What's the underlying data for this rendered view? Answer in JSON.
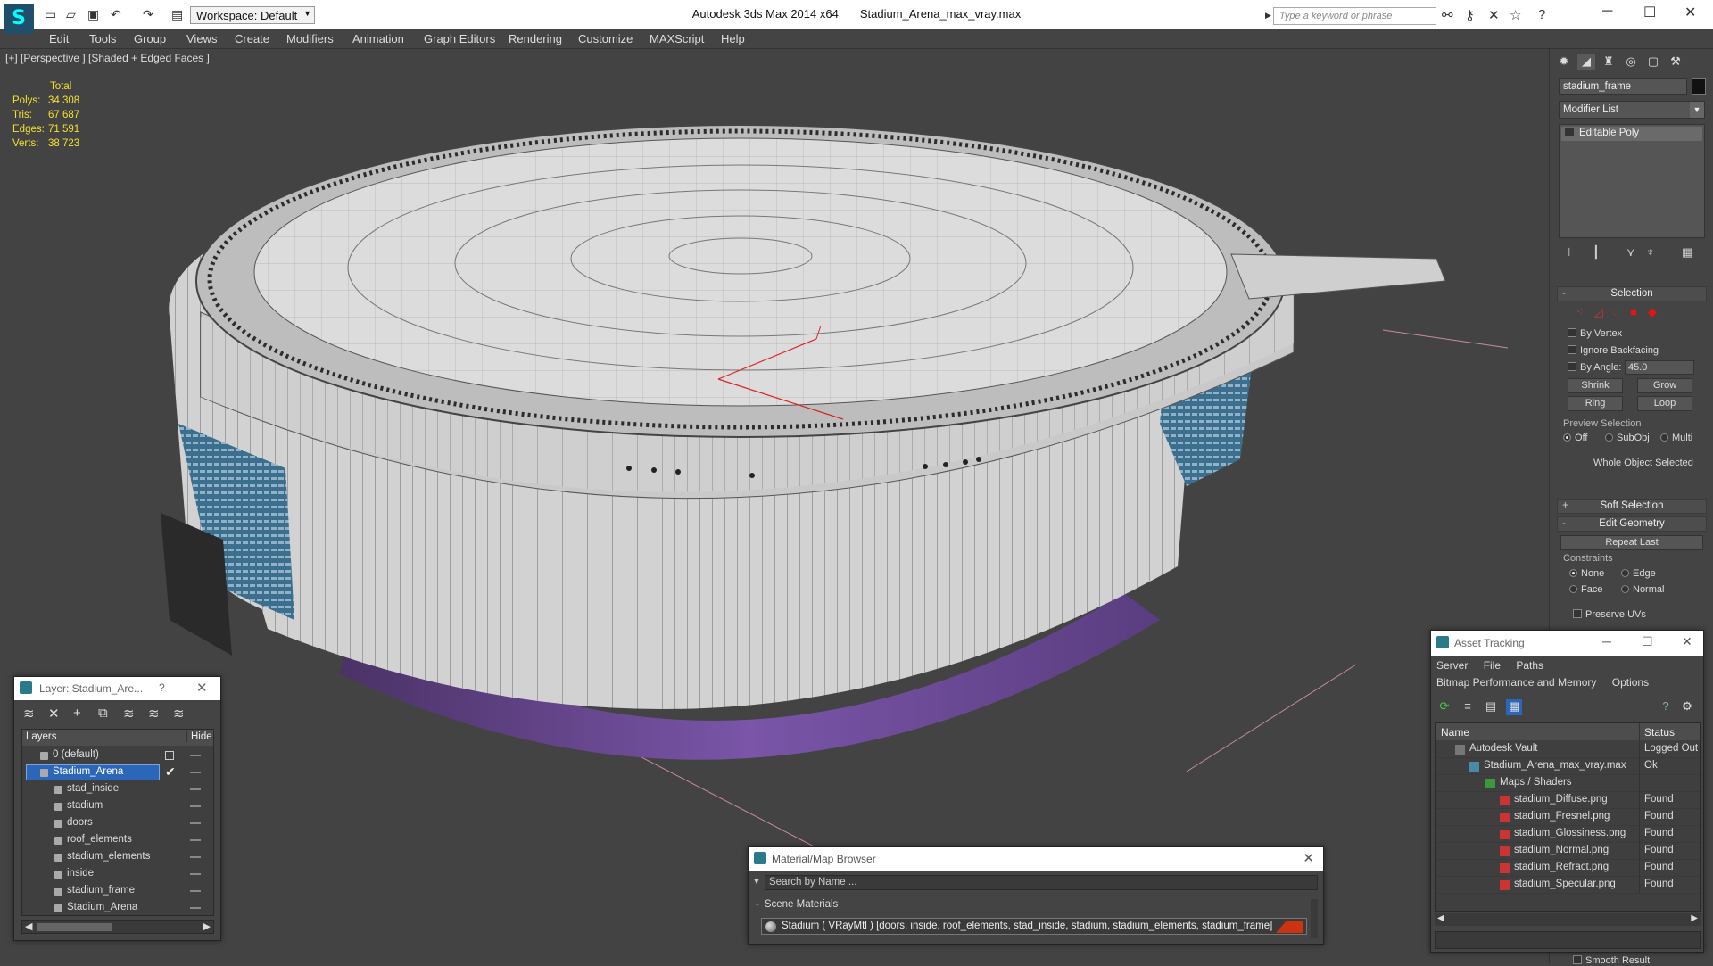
{
  "app": {
    "title": "Autodesk 3ds Max  2014 x64",
    "file": "Stadium_Arena_max_vray.max",
    "workspace": "Workspace: Default",
    "search_placeholder": "Type a keyword or phrase"
  },
  "menu": [
    "Edit",
    "Tools",
    "Group",
    "Views",
    "Create",
    "Modifiers",
    "Animation",
    "Graph Editors",
    "Rendering",
    "Customize",
    "MAXScript",
    "Help"
  ],
  "viewport": {
    "label": "[+] [Perspective ] [Shaded + Edged Faces ]",
    "stats": {
      "header": "Total",
      "rows": [
        {
          "k": "Polys:",
          "v": "34 308"
        },
        {
          "k": "Tris:",
          "v": "67 687"
        },
        {
          "k": "Edges:",
          "v": "71 591"
        },
        {
          "k": "Verts:",
          "v": "38 723"
        }
      ]
    }
  },
  "command_panel": {
    "object_name": "stadium_frame",
    "modifier_list": "Modifier List",
    "stack_item": "Editable Poly",
    "selection": {
      "title": "Selection",
      "by_vertex": "By Vertex",
      "ignore_backfacing": "Ignore Backfacing",
      "by_angle": "By Angle:",
      "angle_value": "45.0",
      "shrink": "Shrink",
      "grow": "Grow",
      "ring": "Ring",
      "loop": "Loop",
      "preview_selection": "Preview Selection",
      "off": "Off",
      "subobj": "SubObj",
      "multi": "Multi",
      "status": "Whole Object Selected"
    },
    "soft_selection": "Soft Selection",
    "edit_geometry": {
      "title": "Edit Geometry",
      "repeat_last": "Repeat Last",
      "constraints": "Constraints",
      "none": "None",
      "edge": "Edge",
      "face": "Face",
      "normal": "Normal",
      "preserve_uvs": "Preserve UVs",
      "smooth_result": "Smooth Result"
    }
  },
  "layer_panel": {
    "title": "Layer: Stadium_Are...",
    "help": "?",
    "col_layers": "Layers",
    "col_hide": "Hide",
    "rows": [
      {
        "name": "0 (default)",
        "level": 0
      },
      {
        "name": "Stadium_Arena",
        "level": 0,
        "selected": true
      },
      {
        "name": "stad_inside",
        "level": 1
      },
      {
        "name": "stadium",
        "level": 1
      },
      {
        "name": "doors",
        "level": 1
      },
      {
        "name": "roof_elements",
        "level": 1
      },
      {
        "name": "stadium_elements",
        "level": 1
      },
      {
        "name": "inside",
        "level": 1
      },
      {
        "name": "stadium_frame",
        "level": 1
      },
      {
        "name": "Stadium_Arena",
        "level": 1
      }
    ]
  },
  "material_browser": {
    "title": "Material/Map Browser",
    "search_placeholder": "Search by Name ...",
    "group": "Scene Materials",
    "item": "Stadium  ( VRayMtl ) [doors, inside, roof_elements, stad_inside, stadium, stadium_elements, stadium_frame]",
    "swatch_color": "#cc3311"
  },
  "asset_tracking": {
    "title": "Asset Tracking",
    "menu1": [
      "Server",
      "File",
      "Paths"
    ],
    "menu2": [
      "Bitmap Performance and Memory",
      "Options"
    ],
    "col_name": "Name",
    "col_status": "Status",
    "rows": [
      {
        "name": "Autodesk Vault",
        "status": "Logged Out",
        "level": 0
      },
      {
        "name": "Stadium_Arena_max_vray.max",
        "status": "Ok",
        "level": 1
      },
      {
        "name": "Maps / Shaders",
        "status": "",
        "level": 2
      },
      {
        "name": "stadium_Diffuse.png",
        "status": "Found",
        "level": 3
      },
      {
        "name": "stadium_Fresnel.png",
        "status": "Found",
        "level": 3
      },
      {
        "name": "stadium_Glossiness.png",
        "status": "Found",
        "level": 3
      },
      {
        "name": "stadium_Normal.png",
        "status": "Found",
        "level": 3
      },
      {
        "name": "stadium_Refract.png",
        "status": "Found",
        "level": 3
      },
      {
        "name": "stadium_Specular.png",
        "status": "Found",
        "level": 3
      }
    ]
  }
}
